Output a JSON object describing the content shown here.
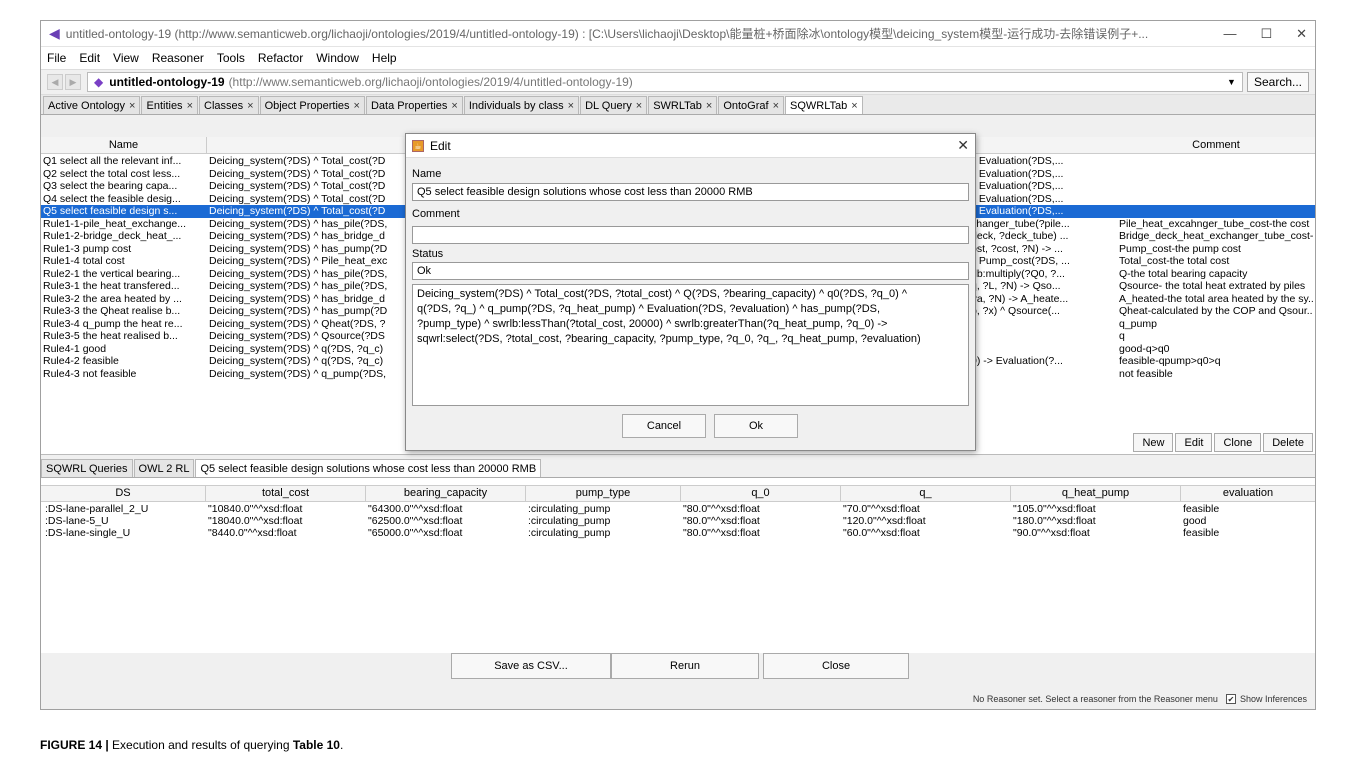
{
  "window": {
    "title": "untitled-ontology-19 (http://www.semanticweb.org/lichaoji/ontologies/2019/4/untitled-ontology-19) : [C:\\Users\\lichaoji\\Desktop\\能量桩+桥面除冰\\ontology模型\\deicing_system模型-运行成功-去除错误例子+...",
    "minimize": "—",
    "maximize": "☐",
    "close": "✕"
  },
  "menu": [
    "File",
    "Edit",
    "View",
    "Reasoner",
    "Tools",
    "Refactor",
    "Window",
    "Help"
  ],
  "address": {
    "name": "untitled-ontology-19",
    "uri": "(http://www.semanticweb.org/lichaoji/ontologies/2019/4/untitled-ontology-19)",
    "search_label": "Search..."
  },
  "tabs": [
    {
      "label": "Active Ontology",
      "x": "×"
    },
    {
      "label": "Entities",
      "x": "×"
    },
    {
      "label": "Classes",
      "x": "×"
    },
    {
      "label": "Object Properties",
      "x": "×"
    },
    {
      "label": "Data Properties",
      "x": "×"
    },
    {
      "label": "Individuals by class",
      "x": "×"
    },
    {
      "label": "DL Query",
      "x": "×"
    },
    {
      "label": "SWRLTab",
      "x": "×"
    },
    {
      "label": "OntoGraf",
      "x": "×"
    },
    {
      "label": "SQWRLTab",
      "x": "×"
    }
  ],
  "rules_table": {
    "headers": {
      "name": "Name",
      "comment": "Comment"
    },
    "rows": [
      {
        "name": "Q1 select all the relevant inf...",
        "body": "Deicing_system(?DS) ^ Total_cost(?D",
        "tail": "^ Evaluation(?DS,...",
        "comment": ""
      },
      {
        "name": "Q2 select the total cost less...",
        "body": "Deicing_system(?DS) ^ Total_cost(?D",
        "tail": "^ Evaluation(?DS,...",
        "comment": ""
      },
      {
        "name": "Q3 select the bearing capa...",
        "body": "Deicing_system(?DS) ^ Total_cost(?D",
        "tail": "^ Evaluation(?DS,...",
        "comment": ""
      },
      {
        "name": "Q4 select the feasible desig...",
        "body": "Deicing_system(?DS) ^ Total_cost(?D",
        "tail": "^ Evaluation(?DS,...",
        "comment": ""
      },
      {
        "name": "Q5 select feasible design s...",
        "body": "Deicing_system(?DS) ^ Total_cost(?D",
        "tail": "^ Evaluation(?DS,...",
        "comment": ""
      },
      {
        "name": "Rule1-1-pile_heat_exchange...",
        "body": "Deicing_system(?DS) ^ has_pile(?DS,",
        "tail": "changer_tube(?pile...",
        "comment": "Pile_heat_excahnger_tube_cost-the cost ..."
      },
      {
        "name": "Rule1-2-bridge_deck_heat_...",
        "body": "Deicing_system(?DS) ^ has_bridge_d",
        "tail": "deck, ?deck_tube) ...",
        "comment": "Bridge_deck_heat_exchanger_tube_cost-t..."
      },
      {
        "name": "Rule1-3 pump cost",
        "body": "Deicing_system(?DS) ^ has_pump(?D",
        "tail": "ost, ?cost, ?N) -> ...",
        "comment": "Pump_cost-the pump cost"
      },
      {
        "name": "Rule1-4 total cost",
        "body": "Deicing_system(?DS) ^ Pile_heat_exc",
        "tail": "^ Pump_cost(?DS, ...",
        "comment": "Total_cost-the total cost"
      },
      {
        "name": "Rule2-1 the vertical bearing...",
        "body": "Deicing_system(?DS) ^ has_pile(?DS,",
        "tail": "rlb:multiply(?Q0, ?...",
        "comment": "Q-the total bearing capacity"
      },
      {
        "name": "Rule3-1 the heat transfered...",
        "body": "Deicing_system(?DS) ^ has_pile(?DS,",
        "tail": "q, ?L, ?N) -> Qso...",
        "comment": "Qsource- the total heat extrated by piles"
      },
      {
        "name": "Rule3-2 the area heated by ...",
        "body": "Deicing_system(?DS) ^ has_bridge_d",
        "tail": "?a, ?N) -> A_heate...",
        "comment": "A_heated-the total area heated by the sy..."
      },
      {
        "name": "Rule3-3 the Qheat realise b...",
        "body": "Deicing_system(?DS) ^ has_pump(?D",
        "tail": "p, ?x) ^ Qsource(...",
        "comment": "Qheat-calculated by the COP and Qsour..."
      },
      {
        "name": "Rule3-4 q_pump the heat re...",
        "body": "Deicing_system(?DS) ^ Qheat(?DS, ?",
        "tail": "",
        "comment": "q_pump"
      },
      {
        "name": "Rule3-5 the heat realised b...",
        "body": "Deicing_system(?DS) ^ Qsource(?DS",
        "tail": "",
        "comment": "q"
      },
      {
        "name": "Rule4-1 good",
        "body": "Deicing_system(?DS) ^ q(?DS, ?q_c)",
        "tail": "",
        "comment": "good-q>q0"
      },
      {
        "name": "Rule4-2 feasible",
        "body": "Deicing_system(?DS) ^ q(?DS, ?q_c)",
        "tail": "0) -> Evaluation(?...",
        "comment": "feasible-qpump>q0>q"
      },
      {
        "name": "Rule4-3 not feasible",
        "body": "Deicing_system(?DS) ^ q_pump(?DS,",
        "tail": "",
        "comment": "not feasible"
      }
    ],
    "selected_index": 4,
    "buttons": {
      "new": "New",
      "edit": "Edit",
      "clone": "Clone",
      "delete": "Delete"
    }
  },
  "dialog": {
    "title": "Edit",
    "close": "✕",
    "name_label": "Name",
    "name_value": "Q5 select feasible design solutions whose cost less than 20000 RMB",
    "comment_label": "Comment",
    "comment_value": "",
    "status_label": "Status",
    "status_value": "Ok",
    "rule_lines": [
      "Deicing_system(?DS) ^ Total_cost(?DS, ?total_cost) ^ Q(?DS, ?bearing_capacity) ^ q0(?DS, ?q_0) ^",
      "q(?DS, ?q_) ^ q_pump(?DS, ?q_heat_pump) ^ Evaluation(?DS, ?evaluation) ^ has_pump(?DS,",
      "?pump_type) ^ swrlb:lessThan(?total_cost, 20000) ^ swrlb:greaterThan(?q_heat_pump, ?q_0) ->",
      "sqwrl:select(?DS, ?total_cost, ?bearing_capacity, ?pump_type, ?q_0, ?q_, ?q_heat_pump, ?evaluation)"
    ],
    "cancel_label": "Cancel",
    "ok_label": "Ok"
  },
  "lower_tabs": [
    "SQWRL Queries",
    "OWL 2 RL",
    "Q5 select feasible design solutions whose cost less than 20000 RMB"
  ],
  "results": {
    "headers": [
      "DS",
      "total_cost",
      "bearing_capacity",
      "pump_type",
      "q_0",
      "q_",
      "q_heat_pump",
      "evaluation"
    ],
    "rows": [
      [
        ":DS-lane-parallel_2_U",
        "\"10840.0\"^^xsd:float",
        "\"64300.0\"^^xsd:float",
        ":circulating_pump",
        "\"80.0\"^^xsd:float",
        "\"70.0\"^^xsd:float",
        "\"105.0\"^^xsd:float",
        "feasible"
      ],
      [
        ":DS-lane-5_U",
        "\"18040.0\"^^xsd:float",
        "\"62500.0\"^^xsd:float",
        ":circulating_pump",
        "\"80.0\"^^xsd:float",
        "\"120.0\"^^xsd:float",
        "\"180.0\"^^xsd:float",
        "good"
      ],
      [
        ":DS-lane-single_U",
        "\"8440.0\"^^xsd:float",
        "\"65000.0\"^^xsd:float",
        ":circulating_pump",
        "\"80.0\"^^xsd:float",
        "\"60.0\"^^xsd:float",
        "\"90.0\"^^xsd:float",
        "feasible"
      ]
    ]
  },
  "bottom_buttons": {
    "save": "Save as CSV...",
    "rerun": "Rerun",
    "close": "Close"
  },
  "status": {
    "text": "No Reasoner set. Select a reasoner from the Reasoner menu",
    "show_inferences": "Show Inferences"
  },
  "caption": {
    "prefix": "FIGURE 14 |",
    "text": " Execution and results of querying ",
    "ref": "Table 10",
    "suffix": "."
  }
}
